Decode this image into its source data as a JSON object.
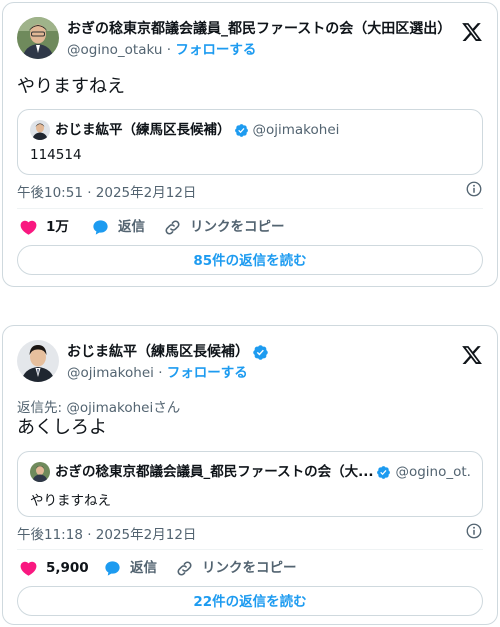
{
  "colors": {
    "accent": "#1d9bf0",
    "like": "#f91880",
    "border": "#cfd9de",
    "muted": "#536471"
  },
  "tweets": [
    {
      "author_name": "おぎの稔東京都議会議員_都民ファーストの会（大田区選出）",
      "handle": "@ogino_otaku",
      "separator": "·",
      "follow_label": "フォローする",
      "text": "やりますねえ",
      "quote": {
        "author_name": "おじま紘平（練馬区長候補）",
        "handle": "@ojimakohei",
        "text": "114514"
      },
      "timestamp": "午後10:51 · 2025年2月12日",
      "likes": "1万",
      "reply_label": "返信",
      "copy_link_label": "リンクをコピー",
      "read_replies_label": "85件の返信を読む"
    },
    {
      "author_name": "おじま紘平（練馬区長候補）",
      "handle": "@ojimakohei",
      "separator": "·",
      "follow_label": "フォローする",
      "reply_to": "返信先: @ojimakoheiさん",
      "text": "あくしろよ",
      "quote": {
        "author_name": "おぎの稔東京都議会議員_都民ファーストの会（大...",
        "handle": "@ogino_ot...",
        "text": "やりますねえ"
      },
      "timestamp": "午後11:18 · 2025年2月12日",
      "likes": "5,900",
      "reply_label": "返信",
      "copy_link_label": "リンクをコピー",
      "read_replies_label": "22件の返信を読む"
    }
  ]
}
